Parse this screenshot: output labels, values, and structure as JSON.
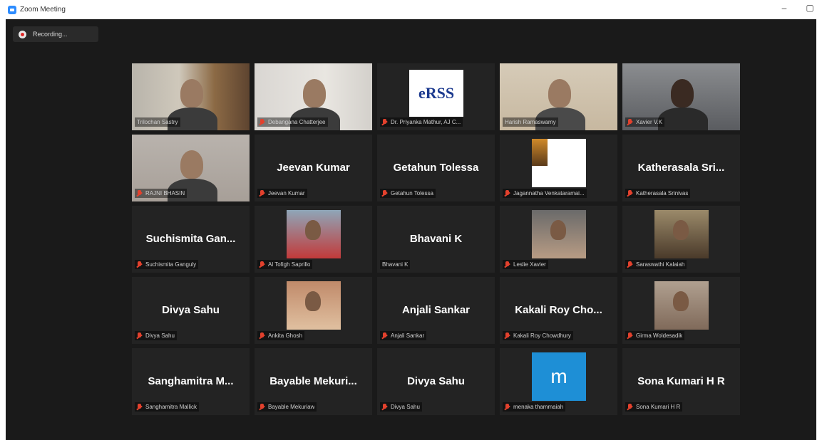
{
  "window": {
    "title": "Zoom Meeting",
    "minimize": "–",
    "restore": "▢"
  },
  "recording": {
    "label": "Recording..."
  },
  "colors": {
    "accent": "#2D8CFF",
    "active_speaker": "#c8d52a",
    "muted_mic": "#e3412d"
  },
  "participants": [
    {
      "name": "Trilochan Sastry",
      "big_name": "",
      "video": "room",
      "muted": false
    },
    {
      "name": "Debangana Chatterjee",
      "big_name": "",
      "video": "plain",
      "muted": true
    },
    {
      "name": "Dr. Priyanka Mathur, AJ C...",
      "big_name": "",
      "video": "logo",
      "logo_text": "eRSS",
      "muted": true
    },
    {
      "name": "Harish Ramaswamy",
      "big_name": "",
      "video": "office",
      "muted": false
    },
    {
      "name": "Xavier V.K",
      "big_name": "",
      "video": "dark",
      "muted": true
    },
    {
      "name": "RAJNI BHASIN",
      "big_name": "",
      "video": "wall",
      "muted": true
    },
    {
      "name": "Jeevan Kumar",
      "big_name": "Jeevan Kumar",
      "video": "none",
      "muted": true
    },
    {
      "name": "Getahun Tolessa",
      "big_name": "Getahun Tolessa",
      "video": "none",
      "muted": true
    },
    {
      "name": "Jagannatha Venkataramai...",
      "big_name": "",
      "video": "thumb",
      "muted": true
    },
    {
      "name": "Katherasala Srinivas",
      "big_name": "Katherasala Sri...",
      "video": "none",
      "muted": true
    },
    {
      "name": "Suchismita Ganguly",
      "big_name": "Suchismita Gan...",
      "video": "none",
      "muted": true
    },
    {
      "name": "Al Tofigh Saprillo",
      "big_name": "",
      "video": "thumb",
      "muted": true
    },
    {
      "name": "Bhavani K",
      "big_name": "Bhavani K",
      "video": "none",
      "muted": false
    },
    {
      "name": "Leslie Xavier",
      "big_name": "",
      "video": "thumb",
      "muted": true
    },
    {
      "name": "Saraswathi Kalaiah",
      "big_name": "",
      "video": "thumb",
      "muted": true
    },
    {
      "name": "Divya Sahu",
      "big_name": "Divya Sahu",
      "video": "none",
      "muted": true
    },
    {
      "name": "Ankita Ghosh",
      "big_name": "",
      "video": "thumb",
      "muted": true
    },
    {
      "name": "Anjali Sankar",
      "big_name": "Anjali Sankar",
      "video": "none",
      "muted": true
    },
    {
      "name": "Kakali Roy Chowdhury",
      "big_name": "Kakali Roy Cho...",
      "video": "none",
      "muted": true
    },
    {
      "name": "Girma Woldesadik",
      "big_name": "",
      "video": "thumb",
      "muted": true
    },
    {
      "name": "Sanghamitra Mallick",
      "big_name": "Sanghamitra M...",
      "video": "none",
      "muted": true
    },
    {
      "name": "Bayable Mekuriaw",
      "big_name": "Bayable Mekuri...",
      "video": "none",
      "muted": true
    },
    {
      "name": "Divya Sahu",
      "big_name": "Divya Sahu",
      "video": "none",
      "muted": true
    },
    {
      "name": "menaka thammaiah",
      "big_name": "",
      "video": "m-avatar",
      "logo_text": "m",
      "muted": true
    },
    {
      "name": "Sona Kumari H R",
      "big_name": "Sona Kumari H R",
      "video": "none",
      "muted": true
    }
  ]
}
